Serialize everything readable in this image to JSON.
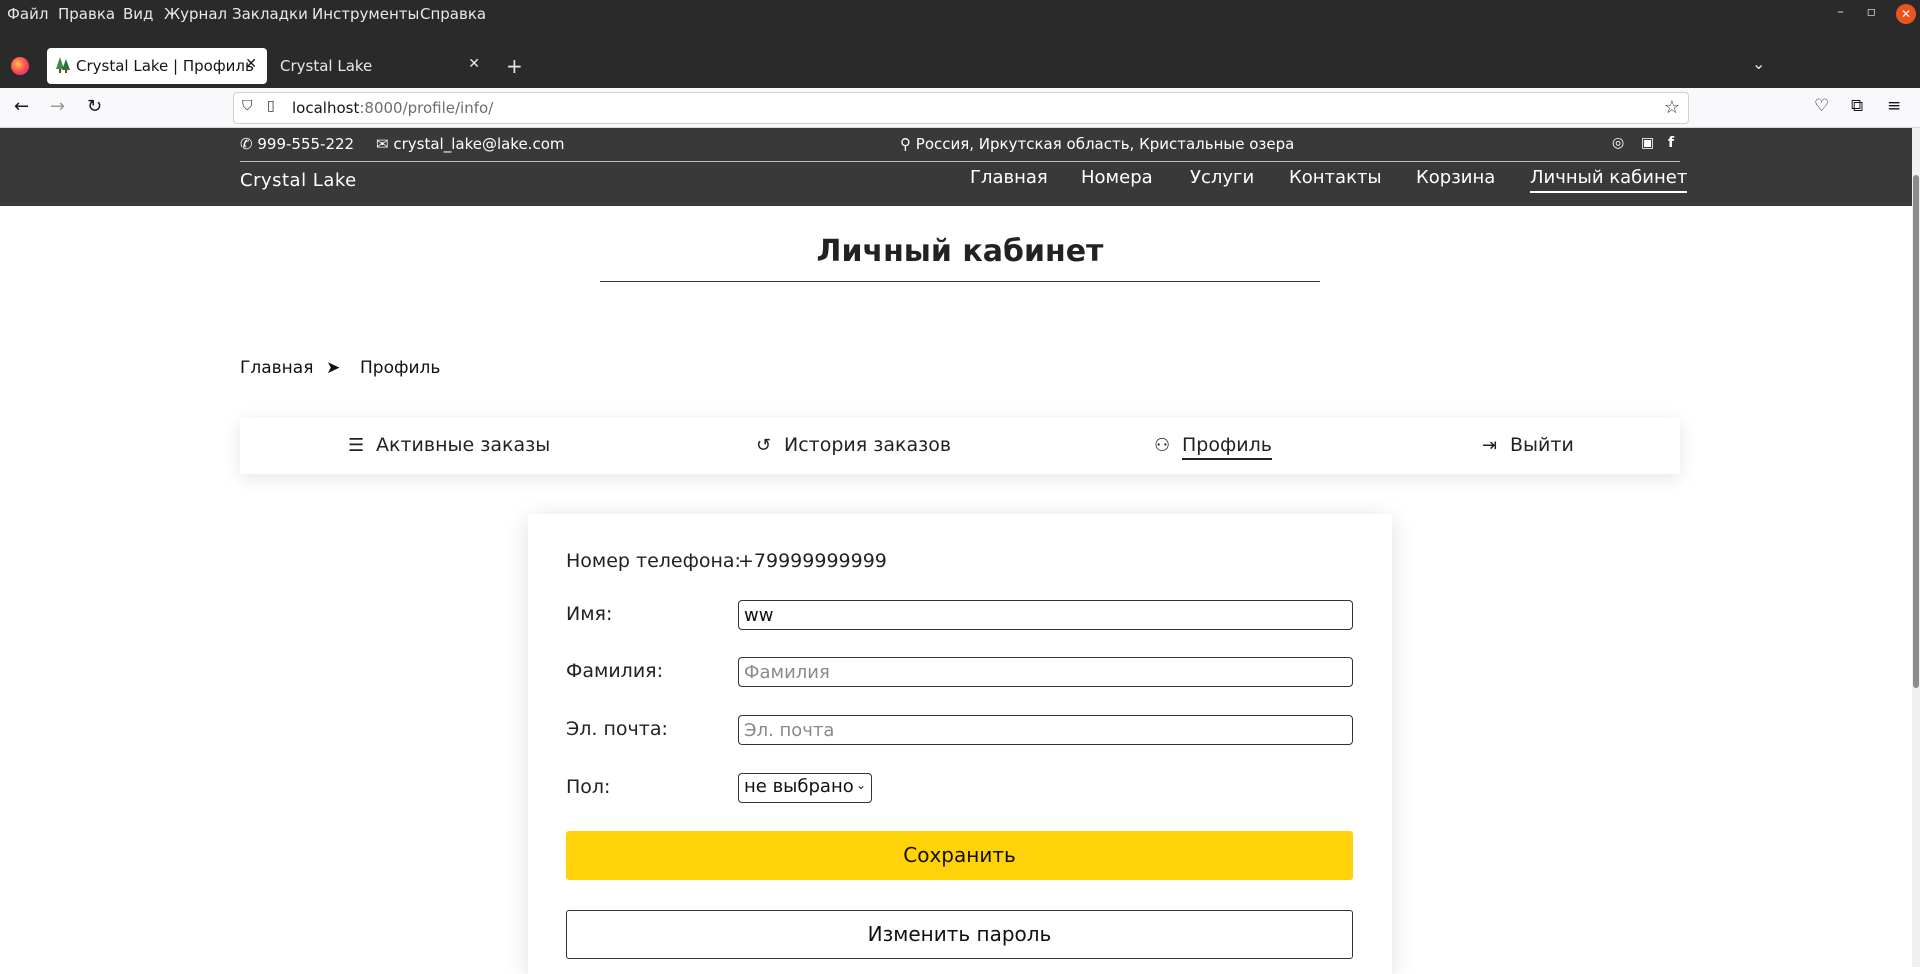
{
  "browser": {
    "menu": [
      "Файл",
      "Правка",
      "Вид",
      "Журнал",
      "Закладки",
      "Инструменты",
      "Справка"
    ],
    "tabs": [
      {
        "label": "Crystal Lake | Профиль",
        "active": true
      },
      {
        "label": "Crystal Lake",
        "active": false
      }
    ],
    "url_host": "localhost",
    "url_rest": ":8000/profile/info/"
  },
  "site": {
    "phone": "999-555-222",
    "email": "crystal_lake@lake.com",
    "address": "Россия, Иркутская область, Кристальные озера",
    "brand": "Crystal Lake",
    "nav": [
      "Главная",
      "Номера",
      "Услуги",
      "Контакты",
      "Корзина",
      "Личный кабинет"
    ],
    "social_icons": [
      "instagram-icon",
      "vk-icon",
      "facebook-icon"
    ]
  },
  "page": {
    "title": "Личный кабинет",
    "breadcrumb": [
      "Главная",
      "Профиль"
    ],
    "tabs": [
      {
        "label": "Активные заказы",
        "icon": "list-icon"
      },
      {
        "label": "История заказов",
        "icon": "history-icon"
      },
      {
        "label": "Профиль",
        "icon": "user-icon"
      },
      {
        "label": "Выйти",
        "icon": "logout-icon"
      }
    ]
  },
  "form": {
    "phone_label": "Номер телефона:",
    "phone_value": "+79999999999",
    "name_label": "Имя:",
    "name_value": "ww",
    "surname_label": "Фамилия:",
    "surname_placeholder": "Фамилия",
    "email_label": "Эл. почта:",
    "email_placeholder": "Эл. почта",
    "gender_label": "Пол:",
    "gender_value": "не выбрано",
    "save_label": "Сохранить",
    "change_password_label": "Изменить пароль"
  },
  "colors": {
    "header_bg": "#393939",
    "save_button": "#ffd20a"
  }
}
